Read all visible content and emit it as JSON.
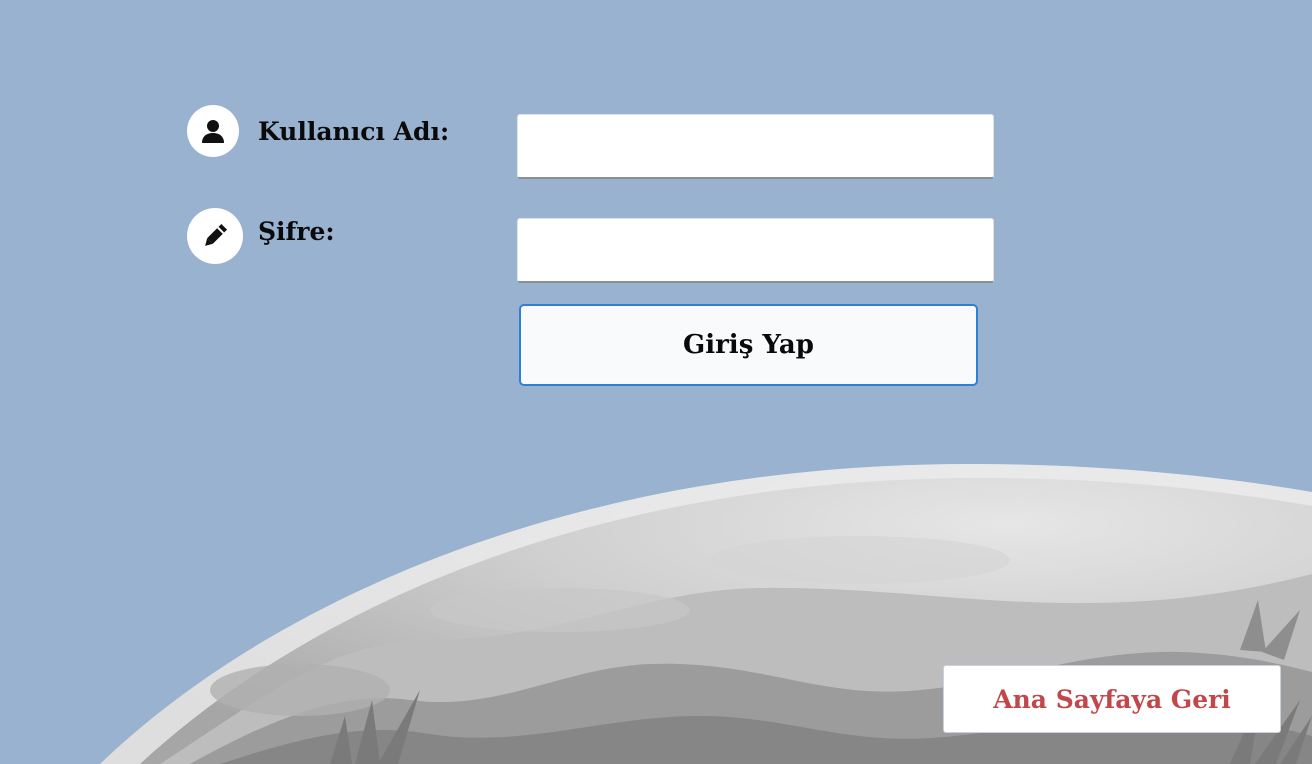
{
  "form": {
    "username": {
      "label": "Kullanıcı Adı:",
      "icon": "user-icon",
      "value": ""
    },
    "password": {
      "label": "Şifre:",
      "icon": "pencil-icon",
      "value": ""
    },
    "submit_label": "Giriş Yap"
  },
  "footer": {
    "back_label": "Ana Sayfaya Geri"
  },
  "colors": {
    "background": "#98b2d0",
    "login_border": "#2f7fd4",
    "back_text": "#c0474a"
  }
}
